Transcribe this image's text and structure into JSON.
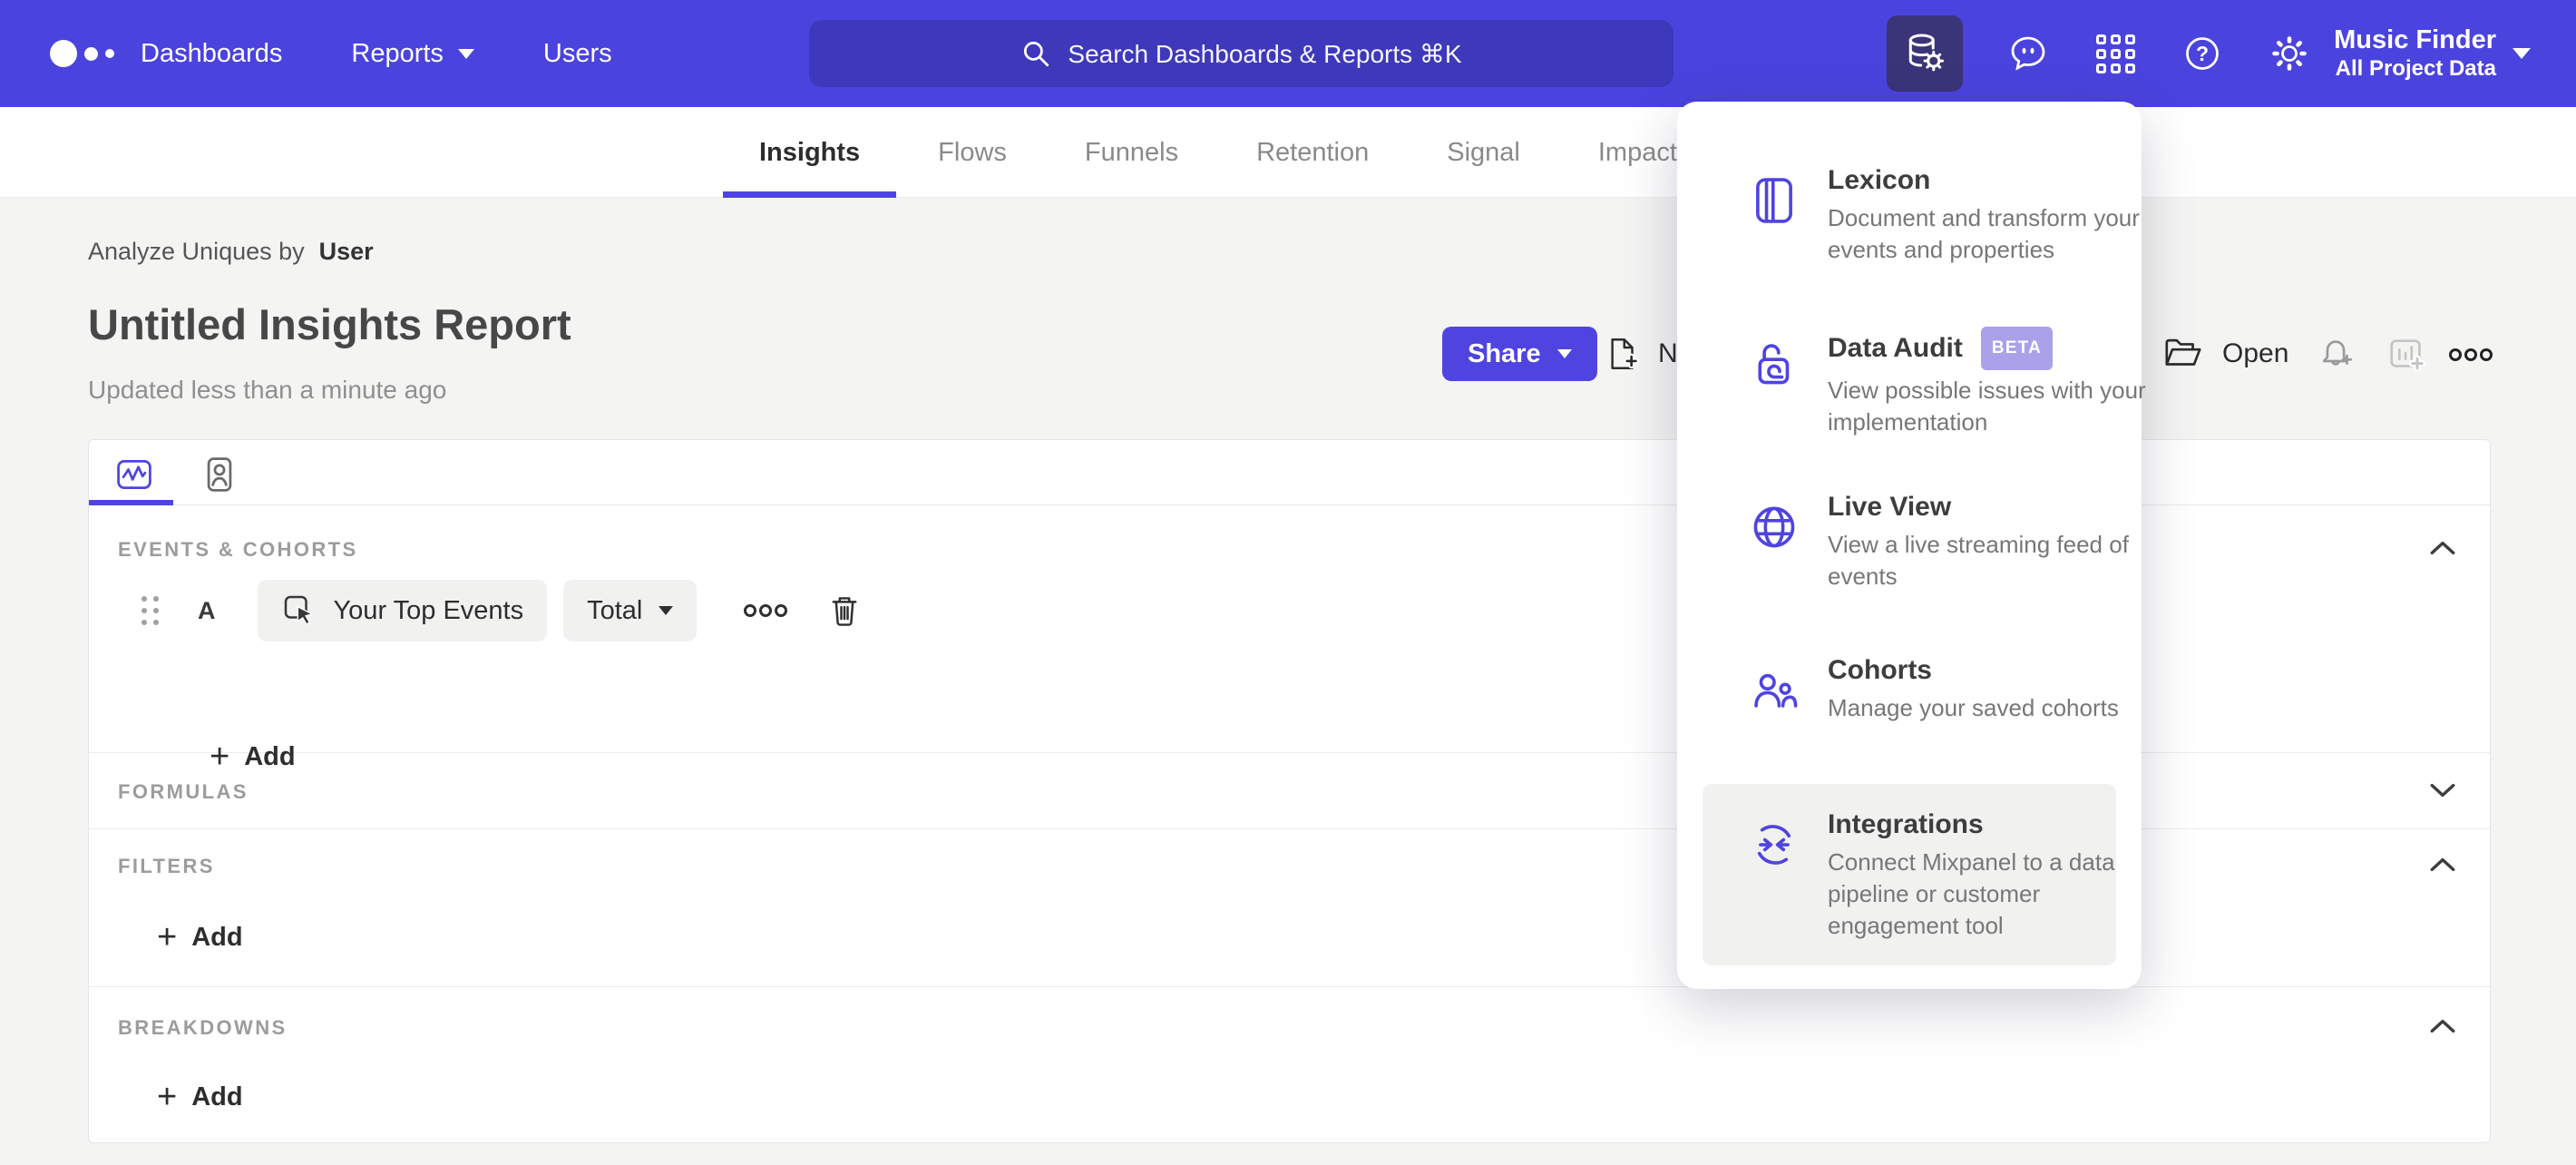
{
  "colors": {
    "brand_purple": "#4b43de",
    "accent": "#4f44e0",
    "nav_active_tile": "#3a3479",
    "beta_badge": "#a9a1ea",
    "page_bg": "#f4f4f3",
    "highlight_row": "#f1f1f0"
  },
  "nav": {
    "logo_icon": "mixpanel-logo",
    "links": [
      {
        "label": "Dashboards"
      },
      {
        "label": "Reports",
        "has_caret": true
      },
      {
        "label": "Users"
      }
    ],
    "search": {
      "placeholder": "Search Dashboards & Reports ⌘K",
      "icon": "search-icon"
    },
    "icons": [
      {
        "name": "data-management-icon",
        "active": true
      },
      {
        "name": "feedback-icon"
      },
      {
        "name": "apps-grid-icon"
      },
      {
        "name": "help-icon"
      },
      {
        "name": "settings-gear-icon"
      }
    ],
    "project": {
      "name": "Music Finder",
      "scope": "All Project Data"
    }
  },
  "tabs": {
    "items": [
      {
        "label": "Insights",
        "active": true
      },
      {
        "label": "Flows"
      },
      {
        "label": "Funnels"
      },
      {
        "label": "Retention"
      },
      {
        "label": "Signal"
      },
      {
        "label": "Impact"
      }
    ]
  },
  "report": {
    "analyze_label": "Analyze Uniques by",
    "analyze_value": "User",
    "title": "Untitled Insights Report",
    "updated": "Updated less than a minute ago",
    "share_label": "Share",
    "new_label": "New",
    "open_label": "Open"
  },
  "builder": {
    "events_label": "EVENTS & COHORTS",
    "row": {
      "letter": "A",
      "event": "Your Top Events",
      "metric": "Total"
    },
    "add_label": "Add",
    "formulas_label": "FORMULAS",
    "filters_label": "FILTERS",
    "breakdowns_label": "BREAKDOWNS"
  },
  "menu": {
    "items": [
      {
        "title": "Lexicon",
        "desc": "Document and transform your events and properties",
        "icon": "book-icon"
      },
      {
        "title": "Data Audit",
        "badge": "BETA",
        "desc": "View possible issues with your implementation",
        "icon": "lock-icon"
      },
      {
        "title": "Live View",
        "desc": "View a live streaming feed of events",
        "icon": "globe-icon"
      },
      {
        "title": "Cohorts",
        "desc": "Manage your saved cohorts",
        "icon": "cohorts-icon"
      },
      {
        "title": "Integrations",
        "desc": "Connect Mixpanel to a data pipeline or customer engagement tool",
        "icon": "integrations-icon",
        "highlighted": true
      }
    ]
  }
}
